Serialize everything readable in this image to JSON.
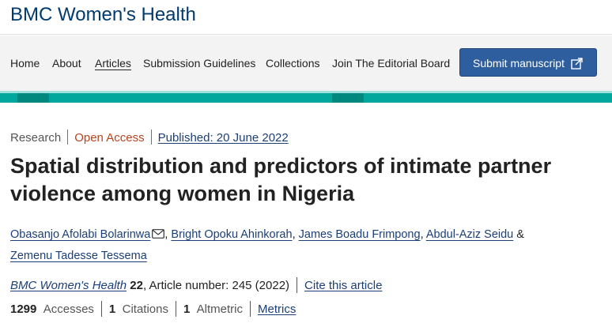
{
  "header": {
    "journal_title": "BMC Women's Health"
  },
  "nav": {
    "items": [
      {
        "label": "Home"
      },
      {
        "label": "About"
      },
      {
        "label": "Articles"
      },
      {
        "label": "Submission Guidelines"
      },
      {
        "label": "Collections"
      },
      {
        "label": "Join The Editorial Board"
      }
    ],
    "active": "Articles",
    "submit_label": "Submit manuscript"
  },
  "colors": {
    "journal": "#003b6f",
    "nav_bg": "#f3f3f3",
    "button": "#2e5e9e",
    "teal": "#01a69d",
    "open_access": "#b8441f",
    "link": "#1b3f78"
  },
  "article": {
    "type": "Research",
    "access": "Open Access",
    "published": "Published: 20 June 2022",
    "title": "Spatial distribution and predictors of intimate partner violence among women in Nigeria",
    "authors": [
      "Obasanjo Afolabi Bolarinwa",
      "Bright Opoku Ahinkorah",
      "James Boadu Frimpong",
      "Abdul-Aziz Seidu",
      "Zemenu Tadesse Tessema"
    ],
    "corresponding_icon": "envelope-icon",
    "citation": {
      "journal": "BMC Women's Health",
      "volume": "22",
      "details": ", Article number: 245 (2022)",
      "cite_link": "Cite this article"
    },
    "metrics": {
      "accesses_value": "1299",
      "accesses_label": "Accesses",
      "citations_value": "1",
      "citations_label": "Citations",
      "altmetric_value": "1",
      "altmetric_label": "Altmetric",
      "metrics_link": "Metrics"
    }
  }
}
